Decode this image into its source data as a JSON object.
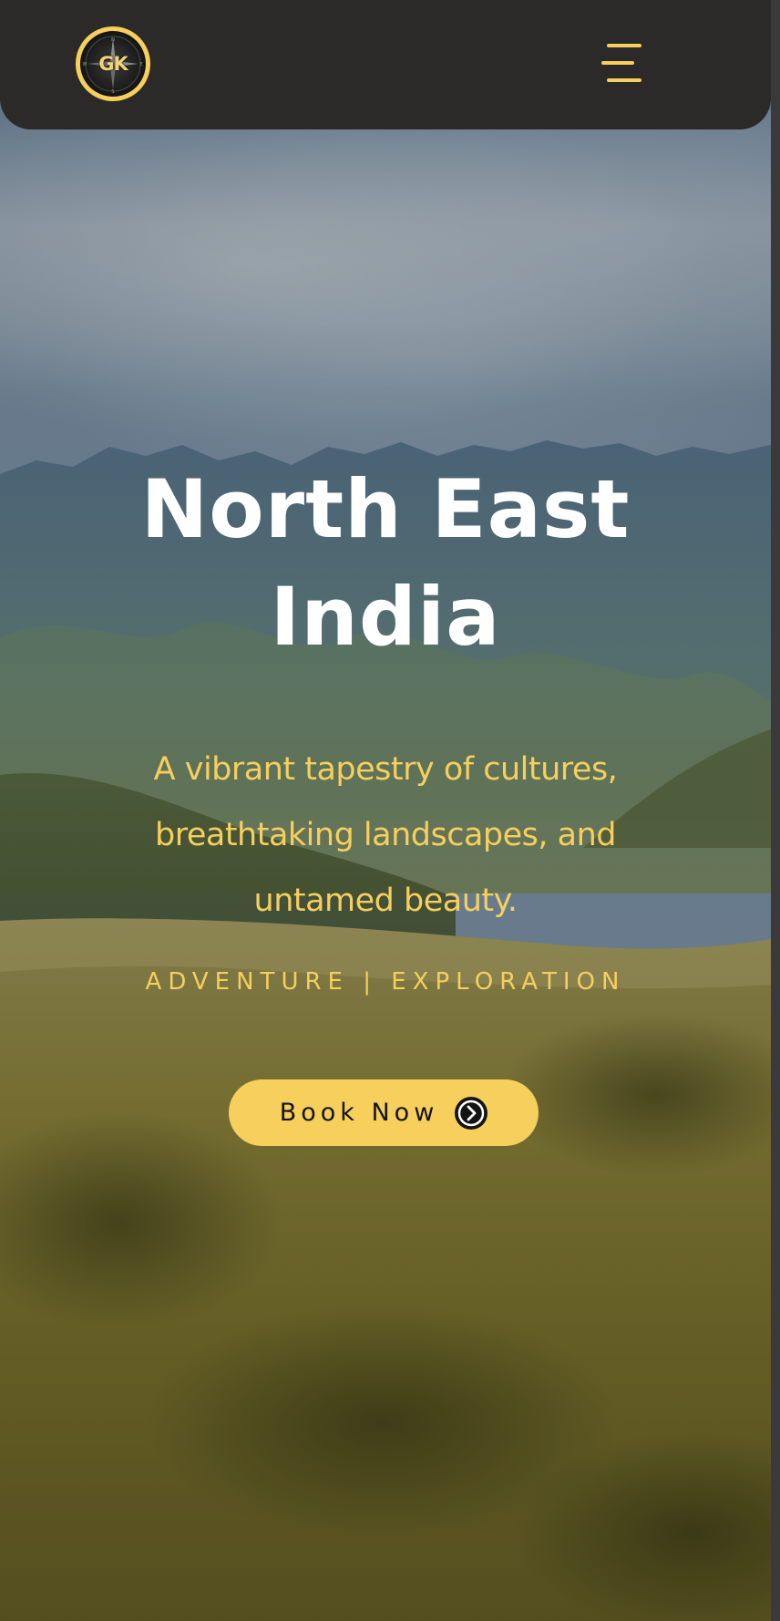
{
  "header": {
    "logo_text": "GK",
    "menu_icon": "hamburger-menu-icon"
  },
  "hero": {
    "title": "North East India",
    "subtitle": "A vibrant tapestry of cultures, breathtaking landscapes, and untamed beauty.",
    "tagline": "ADVENTURE | EXPLORATION",
    "cta_label": "Book Now",
    "cta_icon": "chevron-right-circle-icon"
  },
  "colors": {
    "accent": "#f6cf5c",
    "header_bg": "#2b2a29",
    "title": "#ffffff",
    "button_text": "#141414"
  }
}
